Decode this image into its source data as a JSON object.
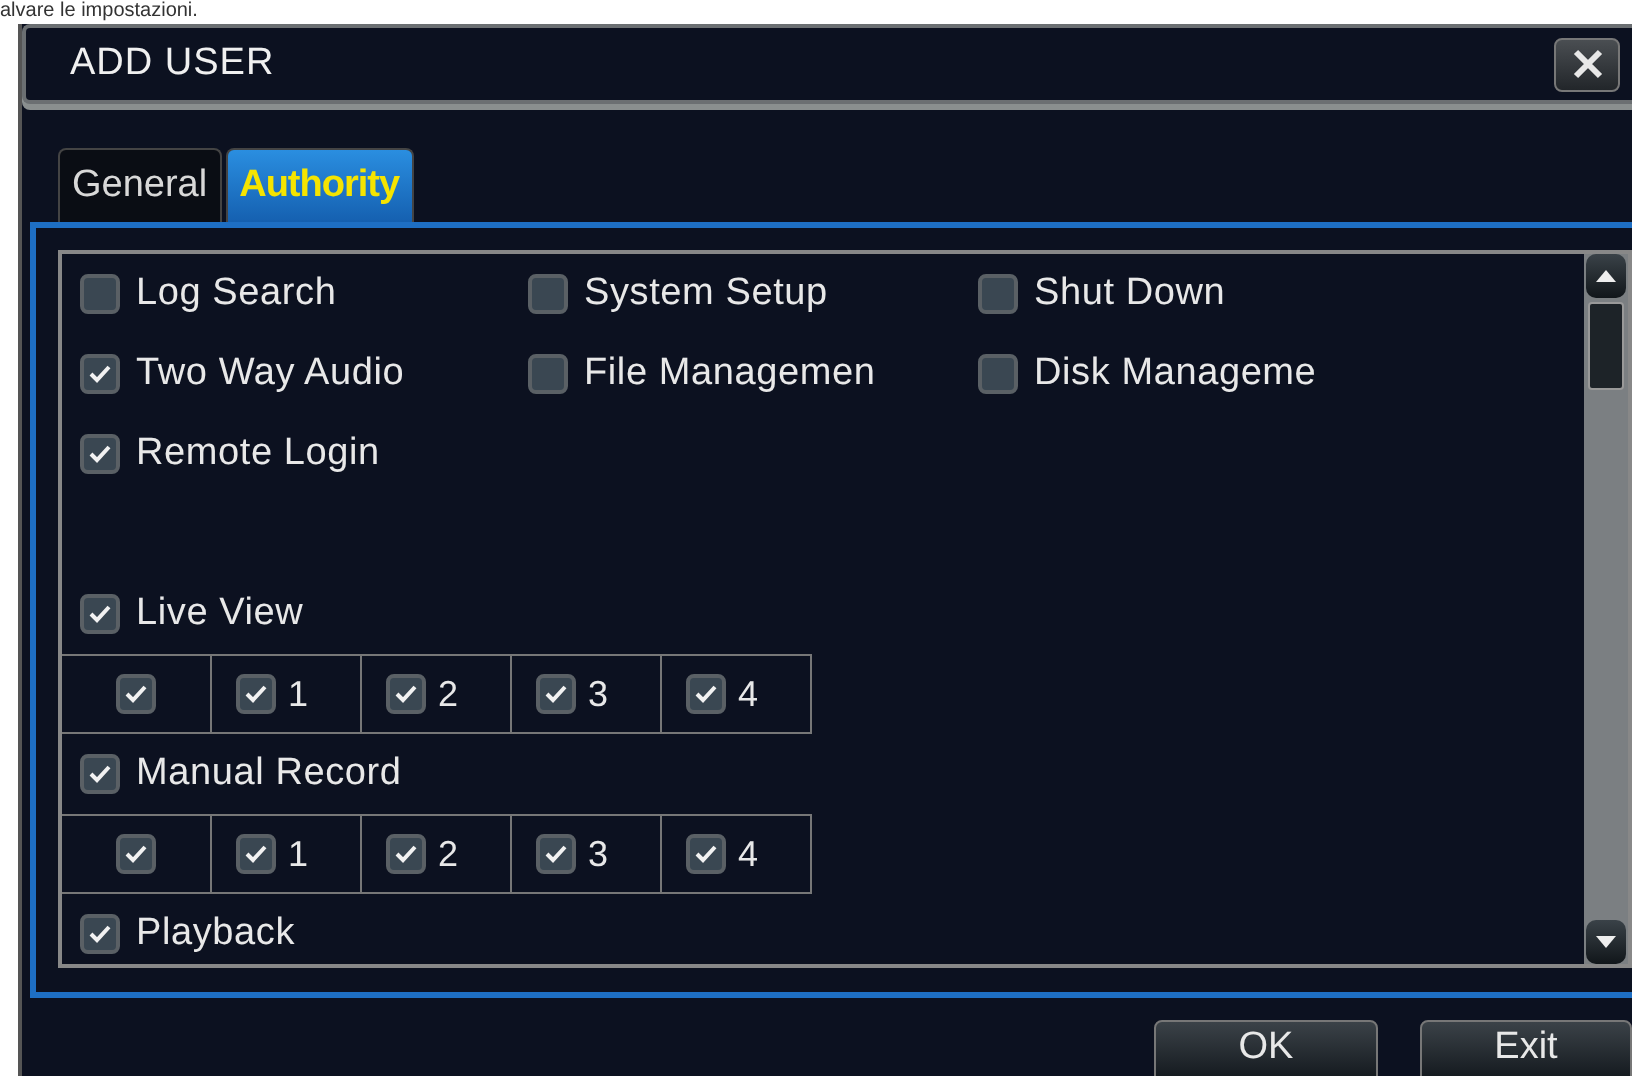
{
  "caption": "alvare le impostazioni.",
  "window": {
    "title": "ADD USER"
  },
  "tabs": [
    {
      "label": "General",
      "selected": false
    },
    {
      "label": "Authority",
      "selected": true
    }
  ],
  "rights": [
    {
      "label": "Log Search",
      "checked": false
    },
    {
      "label": "System Setup",
      "checked": false
    },
    {
      "label": "Shut Down",
      "checked": false
    },
    {
      "label": "Two Way Audio",
      "checked": true
    },
    {
      "label": "File Managemen",
      "checked": false
    },
    {
      "label": "Disk Manageme",
      "checked": false
    },
    {
      "label": "Remote Login",
      "checked": true
    }
  ],
  "channel_rights": [
    {
      "label": "Live View",
      "checked": true,
      "channels": [
        {
          "checked": true
        },
        {
          "label": "1",
          "checked": true
        },
        {
          "label": "2",
          "checked": true
        },
        {
          "label": "3",
          "checked": true
        },
        {
          "label": "4",
          "checked": true
        }
      ]
    },
    {
      "label": "Manual Record",
      "checked": true,
      "channels": [
        {
          "checked": true
        },
        {
          "label": "1",
          "checked": true
        },
        {
          "label": "2",
          "checked": true
        },
        {
          "label": "3",
          "checked": true
        },
        {
          "label": "4",
          "checked": true
        }
      ]
    },
    {
      "label": "Playback",
      "checked": true
    }
  ],
  "buttons": [
    "OK",
    "Exit"
  ]
}
